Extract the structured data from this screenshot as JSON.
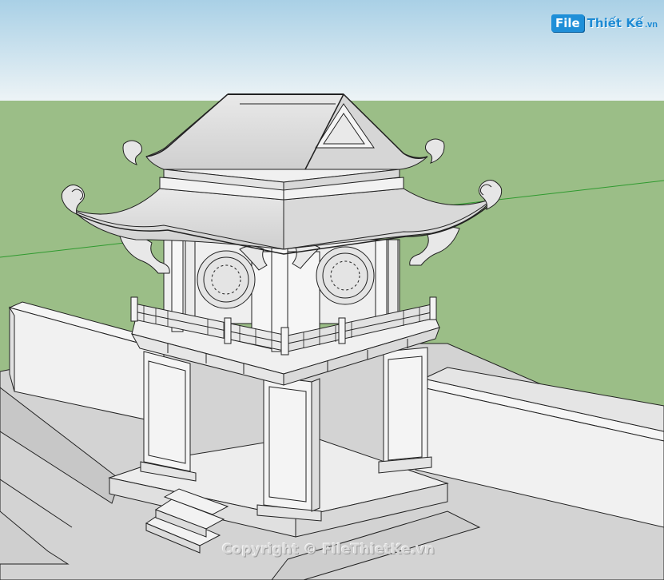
{
  "logo": {
    "badge": "File",
    "name": "Thiết Kế",
    "domain": ".vn"
  },
  "watermark": "Copyright © FileThietKe.vn",
  "colors": {
    "sky": "#cfe3ee",
    "grass": "#9bbe87",
    "ground": "#d2d2d2",
    "structure": "#f4f4f4",
    "outline": "#1e1e1e",
    "axis_green": "#2f9a2f"
  }
}
